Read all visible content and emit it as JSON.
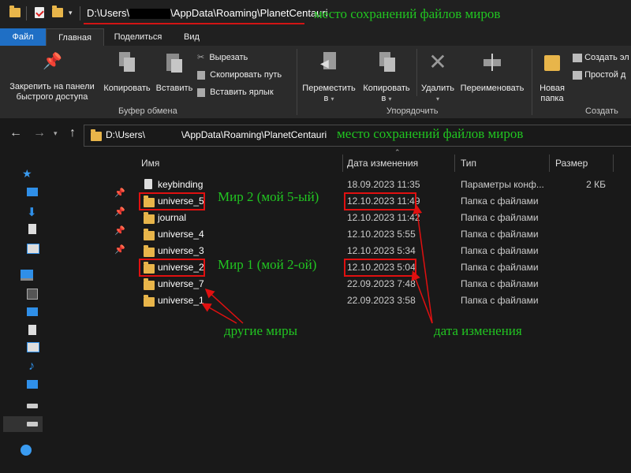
{
  "titlebar": {
    "path_prefix": "D:\\Users\\",
    "path_suffix": "\\AppData\\Roaming\\PlanetCentauri",
    "annotation": "место сохранений файлов миров"
  },
  "tabs": [
    "Файл",
    "Главная",
    "Поделиться",
    "Вид"
  ],
  "ribbon": {
    "pin_label_1": "Закрепить на панели",
    "pin_label_2": "быстрого доступа",
    "copy": "Копировать",
    "paste": "Вставить",
    "cut": "Вырезать",
    "copy_path": "Скопировать путь",
    "paste_shortcut": "Вставить ярлык",
    "group_clipboard": "Буфер обмена",
    "move_to_1": "Переместить",
    "move_to_2": "в",
    "copy_to_1": "Копировать",
    "copy_to_2": "в",
    "delete": "Удалить",
    "rename": "Переименовать",
    "group_organize": "Упорядочить",
    "new_folder_1": "Новая",
    "new_folder_2": "папка",
    "new_item": "Создать эл",
    "easy_access": "Простой д",
    "group_new": "Создать"
  },
  "address": {
    "prefix": "D:\\Users\\",
    "suffix": "\\AppData\\Roaming\\PlanetCentauri",
    "annotation": "место сохранений файлов миров"
  },
  "columns": {
    "name": "Имя",
    "date": "Дата изменения",
    "type": "Тип",
    "size": "Размер"
  },
  "files": [
    {
      "name": "keybinding",
      "date": "18.09.2023 11:35",
      "type": "Параметры конф...",
      "size": "2 КБ"
    },
    {
      "name": "universe_5",
      "date": "12.10.2023 11:49",
      "type": "Папка с файлами",
      "size": ""
    },
    {
      "name": "journal",
      "date": "12.10.2023 11:42",
      "type": "Папка с файлами",
      "size": ""
    },
    {
      "name": "universe_4",
      "date": "12.10.2023 5:55",
      "type": "Папка с файлами",
      "size": ""
    },
    {
      "name": "universe_3",
      "date": "12.10.2023 5:34",
      "type": "Папка с файлами",
      "size": ""
    },
    {
      "name": "universe_2",
      "date": "12.10.2023 5:04",
      "type": "Папка с файлами",
      "size": ""
    },
    {
      "name": "universe_7",
      "date": "22.09.2023 7:48",
      "type": "Папка с файлами",
      "size": ""
    },
    {
      "name": "universe_1",
      "date": "22.09.2023 3:58",
      "type": "Папка с файлами",
      "size": ""
    }
  ],
  "annotations": {
    "world2": "Мир 2 (мой 5-ый)",
    "world1": "Мир 1 (мой 2-ой)",
    "other_worlds": "другие миры",
    "modified_date": "дата изменения"
  },
  "colors": {
    "accent_tab": "#1f6fc5",
    "annotation_green": "#21c521",
    "highlight_red": "#e01010",
    "folder": "#e8b54a"
  }
}
